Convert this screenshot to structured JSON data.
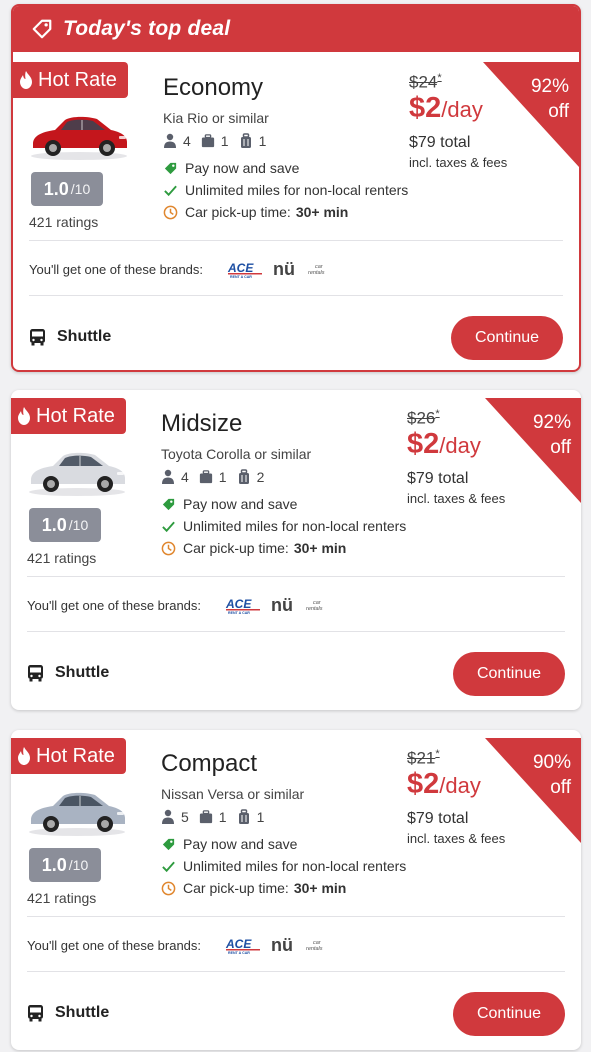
{
  "banner": {
    "text": "Today's top deal"
  },
  "common": {
    "hot_rate": "Hot Rate",
    "score_big": "1.0",
    "score_small": "/10",
    "ratings": "421 ratings",
    "price_amount": "$2",
    "price_per": "/day",
    "total": "$79 total",
    "taxes": "incl. taxes & fees",
    "feature_pay": "Pay now and save",
    "feature_miles": "Unlimited miles for non-local renters",
    "feature_pickup": "Car pick-up time:",
    "feature_pickup_value": "30+ min",
    "brands_label": "You'll get one of these brands:",
    "brand_ace": "ACE",
    "brand_ace_sub": "RENT A CAR",
    "brand_nu": "nü",
    "brand_nu_sub1": "car",
    "brand_nu_sub2": "rentals",
    "shuttle": "Shuttle",
    "continue": "Continue"
  },
  "cards": [
    {
      "title": "Economy",
      "model": "Kia Rio or similar",
      "passengers": "4",
      "bags_large": "1",
      "bags_small": "1",
      "old_price": "$24",
      "old_price_mark": "*",
      "discount_pct": "92%",
      "discount_off": "off",
      "car_color": "#c4161c"
    },
    {
      "title": "Midsize",
      "model": "Toyota Corolla or similar",
      "passengers": "4",
      "bags_large": "1",
      "bags_small": "2",
      "old_price": "$26",
      "old_price_mark": "*",
      "discount_pct": "92%",
      "discount_off": "off",
      "car_color": "#d9dbe0"
    },
    {
      "title": "Compact",
      "model": "Nissan Versa or similar",
      "passengers": "5",
      "bags_large": "1",
      "bags_small": "1",
      "old_price": "$21",
      "old_price_mark": "*",
      "discount_pct": "90%",
      "discount_off": "off",
      "car_color": "#a9b3c2"
    }
  ],
  "colors": {
    "brand_red": "#d0393d",
    "score_gray": "#8b8e99",
    "check_green": "#2e9b3f",
    "clock_orange": "#e0872f"
  }
}
